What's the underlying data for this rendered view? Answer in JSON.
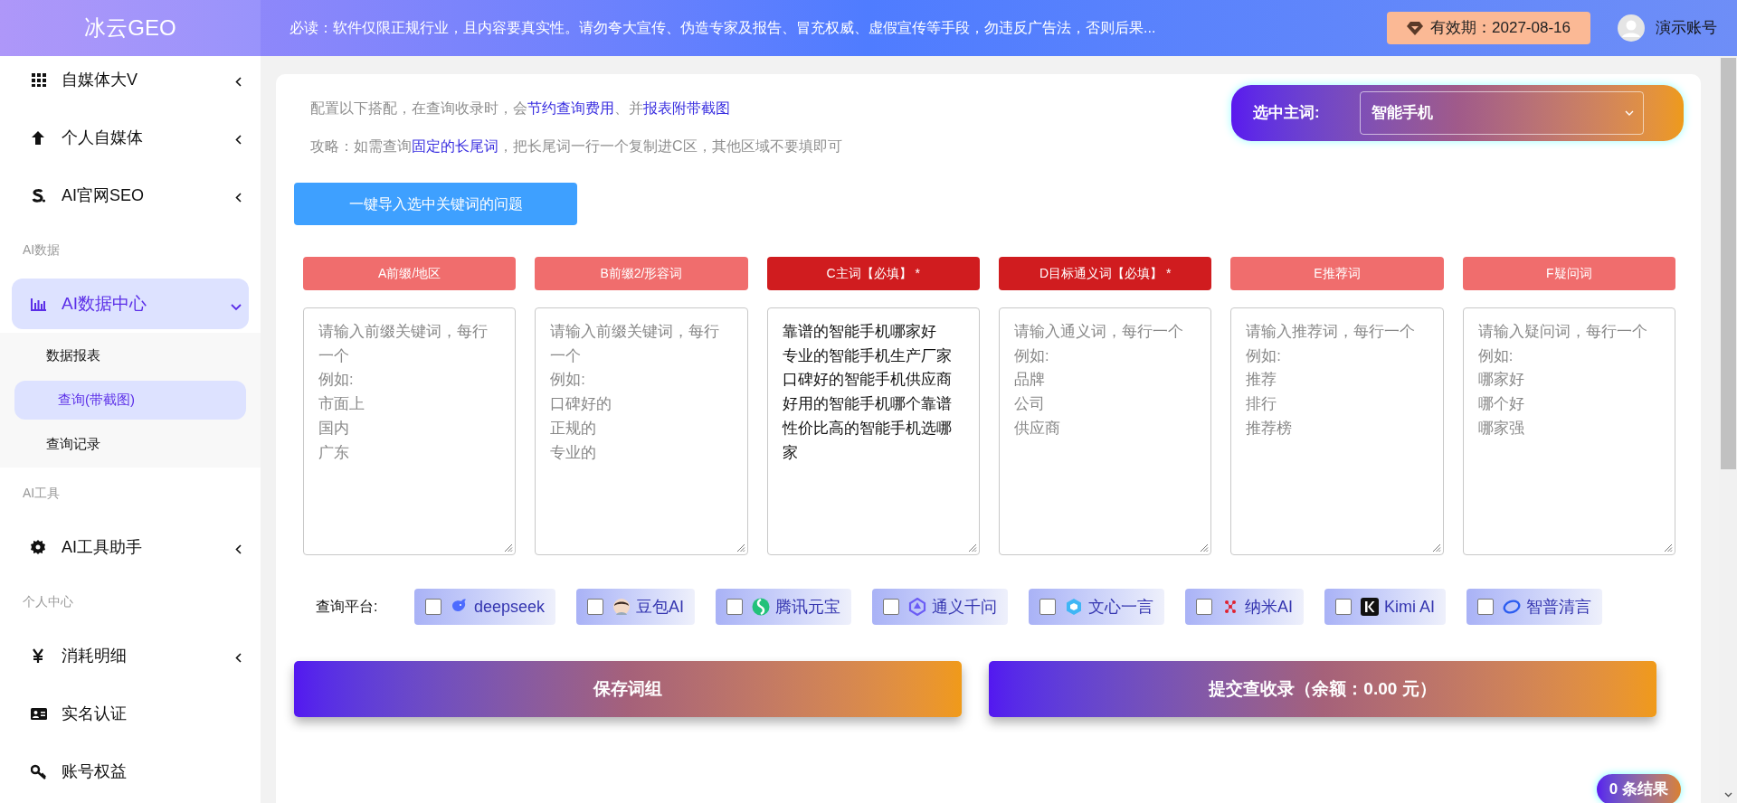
{
  "header": {
    "logo": "冰云GEO",
    "notice": "必读：软件仅限正规行业，且内容要真实性。请勿夸大宣传、伪造专家及报告、冒充权威、虚假宣传等手段，勿违反广告法，否则后果...",
    "expiry": "有效期：2027-08-16",
    "user": "演示账号"
  },
  "sidebar": [
    {
      "kind": "item",
      "label": "自媒体大V",
      "expanded": false,
      "selected": false
    },
    {
      "kind": "item",
      "label": "个人自媒体",
      "expanded": false,
      "selected": false
    },
    {
      "kind": "item",
      "label": "AI官网SEO",
      "expanded": false,
      "selected": false
    },
    {
      "kind": "heading",
      "label": "AI数据"
    },
    {
      "kind": "item",
      "label": "AI数据中心",
      "expanded": true,
      "selected": true,
      "children": [
        {
          "label": "数据报表",
          "selected": false
        },
        {
          "label": "查询(带截图)",
          "selected": true
        },
        {
          "label": "查询记录",
          "selected": false
        }
      ]
    },
    {
      "kind": "heading",
      "label": "AI工具"
    },
    {
      "kind": "item",
      "label": "AI工具助手",
      "expanded": false,
      "selected": false
    },
    {
      "kind": "heading",
      "label": "个人中心"
    },
    {
      "kind": "item",
      "label": "消耗明细",
      "expanded": false,
      "selected": false
    },
    {
      "kind": "item",
      "label": "实名认证",
      "selected": false
    },
    {
      "kind": "item",
      "label": "账号权益",
      "selected": false
    }
  ],
  "intro": [
    [
      {
        "kind": "text",
        "text": "配置以下搭配，在查询收录时，会"
      },
      {
        "kind": "link",
        "text": "节约查询费用"
      },
      {
        "kind": "text",
        "text": "、并"
      },
      {
        "kind": "link",
        "text": "报表附带截图"
      }
    ],
    [
      {
        "kind": "text",
        "text": "攻略：如需查询"
      },
      {
        "kind": "link",
        "text": "固定的长尾词"
      },
      {
        "kind": "text",
        "text": "，把长尾词一行一个复制进C区，其他区域不要填即可"
      }
    ]
  ],
  "keyword_select": {
    "label": "选中主词:",
    "value": "智能手机"
  },
  "import_button": "一键导入选中关键词的问题",
  "columns": [
    {
      "label": "A前缀/地区",
      "required": false,
      "placeholder": [
        "请输入前缀关键词，每行一个",
        "例如:",
        "市面上",
        "国内",
        "广东"
      ]
    },
    {
      "label": "B前缀2/形容词",
      "required": false,
      "placeholder": [
        "请输入前缀关键词，每行一个",
        "例如:",
        "口碑好的",
        "正规的",
        "专业的"
      ]
    },
    {
      "label": "C主词【必填】 *",
      "required": true,
      "value": [
        "靠谱的智能手机哪家好",
        "专业的智能手机生产厂家",
        "口碑好的智能手机供应商",
        "好用的智能手机哪个靠谱",
        "性价比高的智能手机选哪家"
      ]
    },
    {
      "label": "D目标通义词【必填】 *",
      "required": true,
      "placeholder": [
        "请输入通义词，每行一个",
        "例如:",
        "品牌",
        "公司",
        "供应商"
      ]
    },
    {
      "label": "E推荐词",
      "required": false,
      "placeholder": [
        "请输入推荐词，每行一个",
        "例如:",
        "推荐",
        "排行",
        "推荐榜"
      ]
    },
    {
      "label": "F疑问词",
      "required": false,
      "placeholder": [
        "请输入疑问词，每行一个",
        "例如:",
        "哪家好",
        "哪个好",
        "哪家强"
      ]
    }
  ],
  "platforms_label": "查询平台:",
  "platforms": [
    {
      "name": "deepseek",
      "checked": false
    },
    {
      "name": "豆包AI",
      "checked": false
    },
    {
      "name": "腾讯元宝",
      "checked": false
    },
    {
      "name": "通义千问",
      "checked": false
    },
    {
      "name": "文心一言",
      "checked": false
    },
    {
      "name": "纳米AI",
      "checked": false
    },
    {
      "name": "Kimi AI",
      "checked": false
    },
    {
      "name": "智普清言",
      "checked": false
    }
  ],
  "save_button": "保存词组",
  "submit_button": "提交查收录（余额：0.00 元）",
  "results_badge": "0 条结果"
}
